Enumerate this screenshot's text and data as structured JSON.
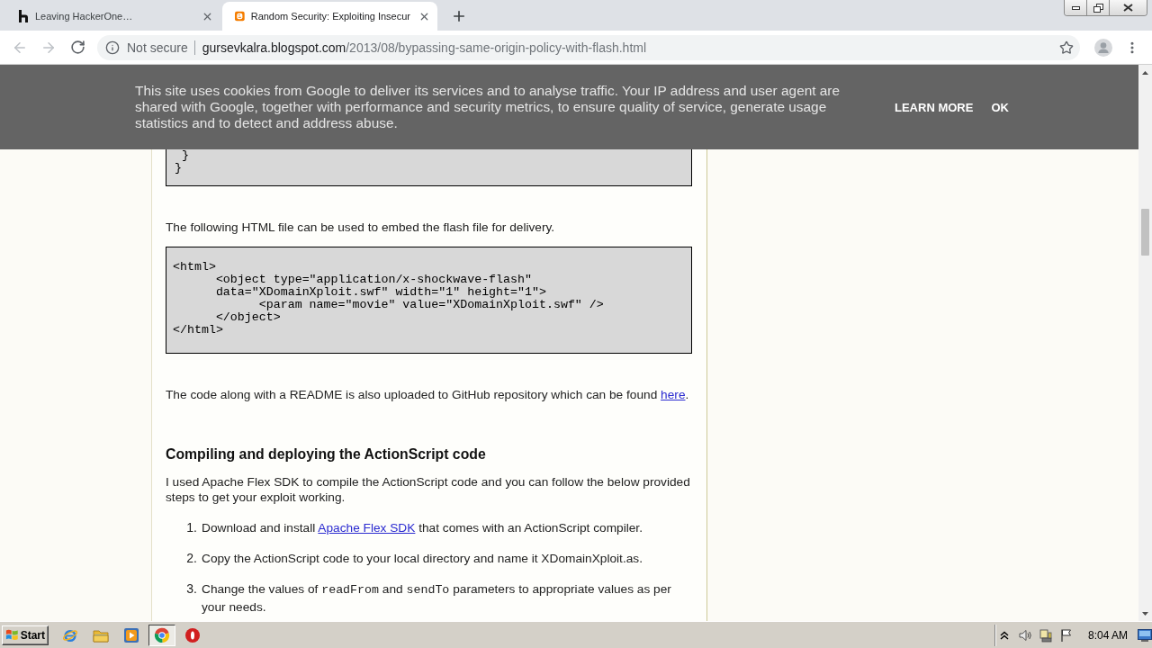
{
  "tabs": [
    {
      "title": "Leaving HackerOne…",
      "selected": false
    },
    {
      "title": "Random Security: Exploiting Insecur",
      "selected": true
    }
  ],
  "toolbar": {
    "back_disabled": true,
    "forward_disabled": true,
    "security_label": "Not secure",
    "url_host": "gursevkalra.blogspot.com",
    "url_path": "/2013/08/bypassing-same-origin-policy-with-flash.html"
  },
  "cookie_banner": {
    "message": "This site uses cookies from Google to deliver its services and to analyse traffic. Your IP address and user agent are shared with Google, together with performance and security metrics, to ensure quality of service, generate usage statistics and to detect and address abuse.",
    "buttons": [
      "LEARN MORE",
      "OK"
    ]
  },
  "article": {
    "blocks": [
      {
        "kind": "code",
        "text": " }\n}"
      },
      {
        "kind": "paragraph",
        "parts": [
          {
            "kind": "text",
            "text": "The following HTML file can be used to embed the flash file for delivery."
          }
        ]
      },
      {
        "kind": "code",
        "text": "<html>\n\t<object type=\"application/x-shockwave-flash\"\n\tdata=\"XDomainXploit.swf\" width=\"1\" height=\"1\">\n\t\t<param name=\"movie\" value=\"XDomainXploit.swf\" />\n\t</object>\n</html>"
      },
      {
        "kind": "paragraph",
        "parts": [
          {
            "kind": "text",
            "text": "The code along with a README is also uploaded to GitHub repository which can be found "
          },
          {
            "kind": "link",
            "text": "here"
          },
          {
            "kind": "text",
            "text": "."
          }
        ]
      },
      {
        "kind": "heading",
        "text": "Compiling and deploying the ActionScript code"
      },
      {
        "kind": "paragraph",
        "parts": [
          {
            "kind": "text",
            "text": "I used Apache Flex SDK to compile the ActionScript code and you can follow the below provided steps to get your exploit working."
          }
        ]
      },
      {
        "kind": "list",
        "items": [
          {
            "number": "1.",
            "parts": [
              {
                "kind": "text",
                "text": "Download and install "
              },
              {
                "kind": "link",
                "text": "Apache Flex SDK"
              },
              {
                "kind": "text",
                "text": " that comes with an ActionScript compiler."
              }
            ]
          },
          {
            "number": "2.",
            "parts": [
              {
                "kind": "text",
                "text": "Copy the ActionScript code to your local directory and name it XDomainXploit.as."
              }
            ]
          },
          {
            "number": "3.",
            "parts": [
              {
                "kind": "text",
                "text": "Change the values of "
              },
              {
                "kind": "code",
                "text": "readFrom"
              },
              {
                "kind": "text",
                "text": " and "
              },
              {
                "kind": "code",
                "text": "sendTo"
              },
              {
                "kind": "text",
                "text": " parameters to appropriate values as per your needs."
              }
            ]
          }
        ]
      }
    ]
  },
  "taskbar": {
    "start_label": "Start",
    "apps": [
      {
        "selected": false
      },
      {
        "selected": false
      },
      {
        "selected": false
      },
      {
        "selected": true
      },
      {
        "selected": false
      }
    ],
    "clock": "8:04 AM"
  }
}
